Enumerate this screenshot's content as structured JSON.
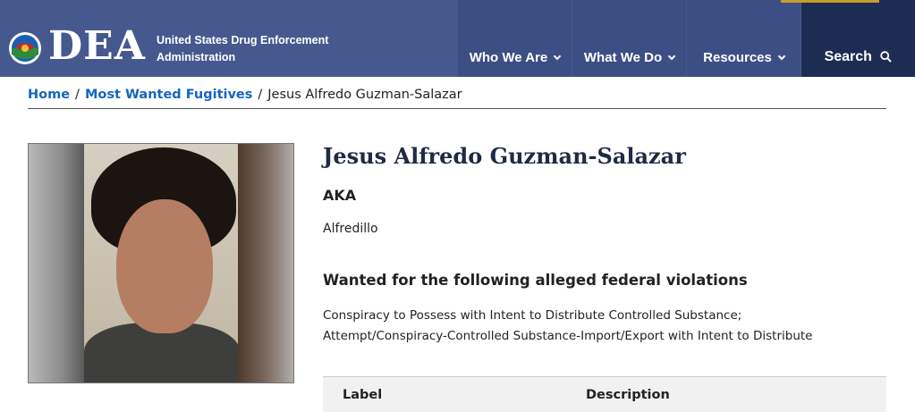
{
  "header": {
    "logo_text": "DEA",
    "agency_name_line1": "United States Drug Enforcement",
    "agency_name_line2": "Administration",
    "nav": [
      {
        "label": "Who We Are",
        "icon": "chevron-down-icon"
      },
      {
        "label": "What We Do",
        "icon": "chevron-down-icon"
      },
      {
        "label": "Resources",
        "icon": "chevron-down-icon"
      }
    ],
    "search_label": "Search",
    "search_icon": "search-icon",
    "colors": {
      "bar": "#45598f",
      "nav": "#3c4f84",
      "search": "#1d2c52",
      "accent": "#c89b2c"
    }
  },
  "breadcrumb": {
    "home": "Home",
    "section": "Most Wanted Fugitives",
    "current": "Jesus Alfredo Guzman-Salazar",
    "separator": "/",
    "link_color": "#1565c0"
  },
  "profile": {
    "name": "Jesus Alfredo Guzman-Salazar",
    "aka_heading": "AKA",
    "aka_value": "Alfredillo",
    "wanted_heading": "Wanted for the following alleged federal violations",
    "violations": [
      "Conspiracy to Possess with Intent to Distribute Controlled Substance;",
      "Attempt/Conspiracy-Controlled Substance-Import/Export with Intent to Distribute"
    ]
  },
  "table": {
    "columns": [
      "Label",
      "Description"
    ]
  }
}
